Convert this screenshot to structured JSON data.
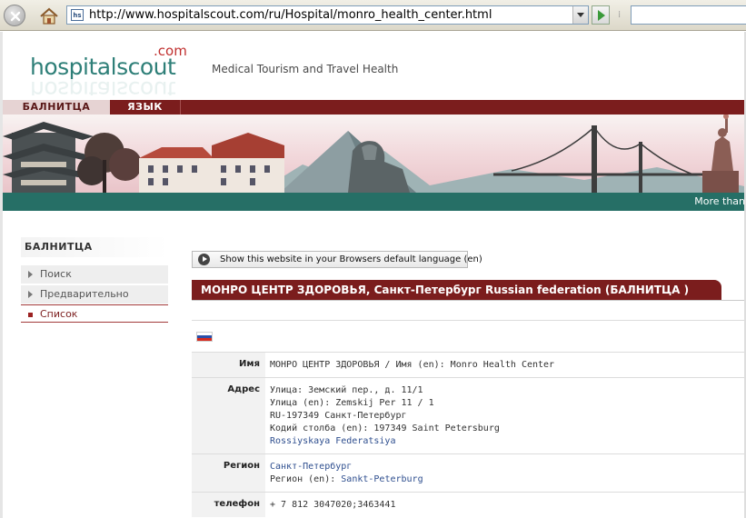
{
  "browser": {
    "url": "http://www.hospitalscout.com/ru/Hospital/monro_health_center.html",
    "favicon_text": "hs"
  },
  "header": {
    "logo_brand_1": "hospital",
    "logo_brand_2": "scout",
    "logo_tld": ".com",
    "tagline": "Medical Tourism and Travel Health"
  },
  "nav": {
    "tabs": [
      {
        "label": "БАЛНИТЦА"
      },
      {
        "label": "ЯЗЫК"
      }
    ]
  },
  "banner": {
    "strip_text": "More than"
  },
  "sidebar": {
    "title": "БАЛНИТЦА",
    "items": [
      {
        "label": "Поиск"
      },
      {
        "label": "Предварительно"
      },
      {
        "label": "Список"
      }
    ]
  },
  "main": {
    "language_button": "Show this website in your Browsers default language  (en)",
    "title": "МОНРО ЦЕНТР ЗДОРОВЬЯ, Санкт-Петербург Russian federation (БАЛНИТЦА )",
    "rows": {
      "name": {
        "label": "Имя",
        "value": "МОНРО ЦЕНТР ЗДОРОВЬЯ / Имя (en): Monro Health Center"
      },
      "address": {
        "label": "Адрес",
        "line1": "Улица: Земский пер., д. 11/1",
        "line2": "Улица (en): Zemskij Per 11 / 1",
        "line3": "RU-197349 Санкт-Петербург",
        "line4": "Кодий столба (en): 197349 Saint Petersburg",
        "line5": "Rossiyskaya Federatsiya"
      },
      "region": {
        "label": "Регион",
        "line1": "Санкт-Петербург",
        "line2_prefix": "Регион (en): ",
        "line2_link": "Sankt-Peterburg"
      },
      "phone": {
        "label": "телефон",
        "value": "+ 7 812 3047020;3463441"
      }
    }
  }
}
